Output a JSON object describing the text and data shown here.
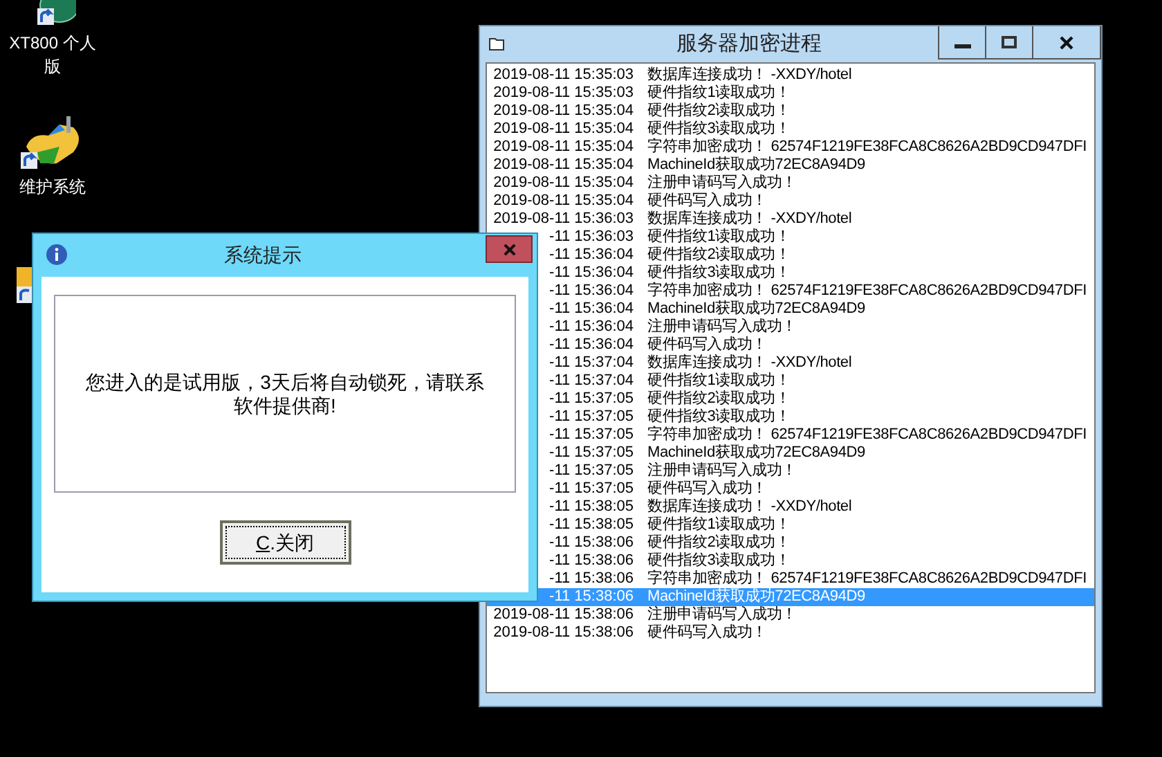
{
  "desktop_icons": [
    {
      "label": "XT800 个人版",
      "kind": "remote"
    },
    {
      "label": "维护系统",
      "kind": "tool"
    },
    {
      "kind": "folder"
    }
  ],
  "log_window": {
    "title": "服务器加密进程",
    "rows": [
      {
        "time": "2019-08-11 15:35:03",
        "message": "数据库连接成功！ -XXDY/hotel",
        "selected": false
      },
      {
        "time": "2019-08-11 15:35:03",
        "message": "硬件指纹1读取成功！",
        "selected": false
      },
      {
        "time": "2019-08-11 15:35:04",
        "message": "硬件指纹2读取成功！",
        "selected": false
      },
      {
        "time": "2019-08-11 15:35:04",
        "message": "硬件指纹3读取成功！",
        "selected": false
      },
      {
        "time": "2019-08-11 15:35:04",
        "message": "字符串加密成功！ 62574F1219FE38FCA8C8626A2BD9CD947DFI",
        "selected": false
      },
      {
        "time": "2019-08-11 15:35:04",
        "message": "MachineId获取成功72EC8A94D9",
        "selected": false
      },
      {
        "time": "2019-08-11 15:35:04",
        "message": "注册申请码写入成功！",
        "selected": false
      },
      {
        "time": "2019-08-11 15:35:04",
        "message": "硬件码写入成功！",
        "selected": false
      },
      {
        "time": "2019-08-11 15:36:03",
        "message": "数据库连接成功！ -XXDY/hotel",
        "selected": false
      },
      {
        "time": "-11 15:36:03",
        "message": "硬件指纹1读取成功！",
        "selected": false
      },
      {
        "time": "-11 15:36:04",
        "message": "硬件指纹2读取成功！",
        "selected": false
      },
      {
        "time": "-11 15:36:04",
        "message": "硬件指纹3读取成功！",
        "selected": false
      },
      {
        "time": "-11 15:36:04",
        "message": "字符串加密成功！ 62574F1219FE38FCA8C8626A2BD9CD947DFI",
        "selected": false
      },
      {
        "time": "-11 15:36:04",
        "message": "MachineId获取成功72EC8A94D9",
        "selected": false
      },
      {
        "time": "-11 15:36:04",
        "message": "注册申请码写入成功！",
        "selected": false
      },
      {
        "time": "-11 15:36:04",
        "message": "硬件码写入成功！",
        "selected": false
      },
      {
        "time": "-11 15:37:04",
        "message": "数据库连接成功！ -XXDY/hotel",
        "selected": false
      },
      {
        "time": "-11 15:37:04",
        "message": "硬件指纹1读取成功！",
        "selected": false
      },
      {
        "time": "-11 15:37:05",
        "message": "硬件指纹2读取成功！",
        "selected": false
      },
      {
        "time": "-11 15:37:05",
        "message": "硬件指纹3读取成功！",
        "selected": false
      },
      {
        "time": "-11 15:37:05",
        "message": "字符串加密成功！ 62574F1219FE38FCA8C8626A2BD9CD947DFI",
        "selected": false
      },
      {
        "time": "-11 15:37:05",
        "message": "MachineId获取成功72EC8A94D9",
        "selected": false
      },
      {
        "time": "-11 15:37:05",
        "message": "注册申请码写入成功！",
        "selected": false
      },
      {
        "time": "-11 15:37:05",
        "message": "硬件码写入成功！",
        "selected": false
      },
      {
        "time": "-11 15:38:05",
        "message": "数据库连接成功！ -XXDY/hotel",
        "selected": false
      },
      {
        "time": "-11 15:38:05",
        "message": "硬件指纹1读取成功！",
        "selected": false
      },
      {
        "time": "-11 15:38:06",
        "message": "硬件指纹2读取成功！",
        "selected": false
      },
      {
        "time": "-11 15:38:06",
        "message": "硬件指纹3读取成功！",
        "selected": false
      },
      {
        "time": "-11 15:38:06",
        "message": "字符串加密成功！ 62574F1219FE38FCA8C8626A2BD9CD947DFI",
        "selected": false
      },
      {
        "time": "-11 15:38:06",
        "message": "MachineId获取成功72EC8A94D9",
        "selected": true
      },
      {
        "time": "2019-08-11 15:38:06",
        "message": "注册申请码写入成功！",
        "selected": false
      },
      {
        "time": "2019-08-11 15:38:06",
        "message": "硬件码写入成功！",
        "selected": false
      }
    ]
  },
  "dialog": {
    "title": "系统提示",
    "message": "您进入的是试用版，3天后将自动锁死，请联系软件提供商!",
    "button": "C.关闭"
  }
}
